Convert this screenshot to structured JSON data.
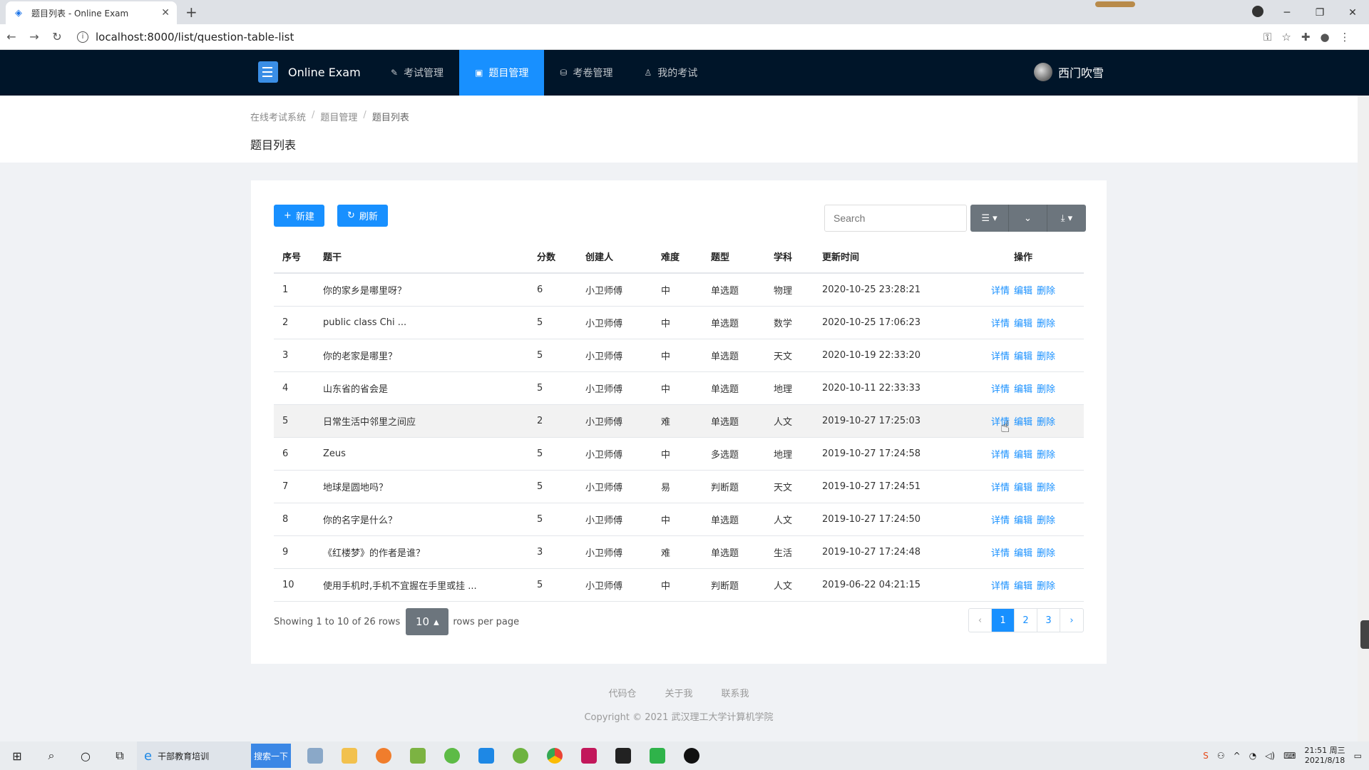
{
  "browser": {
    "tab_title": "题目列表 - Online Exam",
    "url": "localhost:8000/list/question-table-list"
  },
  "app": {
    "brand": "Online Exam",
    "menu": [
      {
        "label": "考试管理",
        "icon": "exam-icon"
      },
      {
        "label": "题目管理",
        "icon": "question-icon",
        "active": true
      },
      {
        "label": "考卷管理",
        "icon": "paper-icon"
      },
      {
        "label": "我的考试",
        "icon": "user-icon"
      }
    ],
    "username": "西门吹雪"
  },
  "breadcrumb": [
    "在线考试系统",
    "题目管理",
    "题目列表"
  ],
  "page_title": "题目列表",
  "toolbar": {
    "new_label": "新建",
    "refresh_label": "刷新",
    "search_placeholder": "Search"
  },
  "table": {
    "columns": [
      "序号",
      "题干",
      "分数",
      "创建人",
      "难度",
      "题型",
      "学科",
      "更新时间",
      "操作"
    ],
    "rows": [
      {
        "no": "1",
        "stem": "你的家乡是哪里呀？",
        "score": "6",
        "creator": "小卫师傅",
        "diff": "中",
        "type": "单选题",
        "subject": "物理",
        "time": "2020-10-25 23:28:21"
      },
      {
        "no": "2",
        "stem": "public class Chi ...",
        "score": "5",
        "creator": "小卫师傅",
        "diff": "中",
        "type": "单选题",
        "subject": "数学",
        "time": "2020-10-25 17:06:23"
      },
      {
        "no": "3",
        "stem": "你的老家是哪里？",
        "score": "5",
        "creator": "小卫师傅",
        "diff": "中",
        "type": "单选题",
        "subject": "天文",
        "time": "2020-10-19 22:33:20"
      },
      {
        "no": "4",
        "stem": "山东省的省会是",
        "score": "5",
        "creator": "小卫师傅",
        "diff": "中",
        "type": "单选题",
        "subject": "地理",
        "time": "2020-10-11 22:33:33"
      },
      {
        "no": "5",
        "stem": "日常生活中邻里之间应",
        "score": "2",
        "creator": "小卫师傅",
        "diff": "难",
        "type": "单选题",
        "subject": "人文",
        "time": "2019-10-27 17:25:03"
      },
      {
        "no": "6",
        "stem": "Zeus",
        "score": "5",
        "creator": "小卫师傅",
        "diff": "中",
        "type": "多选题",
        "subject": "地理",
        "time": "2019-10-27 17:24:58"
      },
      {
        "no": "7",
        "stem": "地球是圆地吗？",
        "score": "5",
        "creator": "小卫师傅",
        "diff": "易",
        "type": "判断题",
        "subject": "天文",
        "time": "2019-10-27 17:24:51"
      },
      {
        "no": "8",
        "stem": "你的名字是什么？",
        "score": "5",
        "creator": "小卫师傅",
        "diff": "中",
        "type": "单选题",
        "subject": "人文",
        "time": "2019-10-27 17:24:50"
      },
      {
        "no": "9",
        "stem": "《红楼梦》的作者是谁？",
        "score": "3",
        "creator": "小卫师傅",
        "diff": "难",
        "type": "单选题",
        "subject": "生活",
        "time": "2019-10-27 17:24:48"
      },
      {
        "no": "10",
        "stem": "使用手机时,手机不宜握在手里或挂 ...",
        "score": "5",
        "creator": "小卫师傅",
        "diff": "中",
        "type": "判断题",
        "subject": "人文",
        "time": "2019-06-22 04:21:15"
      }
    ],
    "ops": [
      "详情",
      "编辑",
      "删除"
    ]
  },
  "pagination": {
    "info": "Showing 1 to 10 of 26 rows",
    "page_size": "10",
    "rows_per_page": "rows per page",
    "prev": "‹",
    "pages": [
      "1",
      "2",
      "3"
    ],
    "next": "›"
  },
  "footer": {
    "links": [
      "代码仓",
      "关于我",
      "联系我"
    ],
    "copyright": "Copyright © 2021 武汉理工大学计算机学院"
  },
  "taskbar": {
    "ie_item": "干部教育培训",
    "baidu": "搜索一下",
    "time": "21:51 周三",
    "date": "2021/8/18"
  },
  "colors": {
    "nav_bg": "#001529",
    "accent": "#1890ff",
    "tool_gray": "#6c757d"
  }
}
